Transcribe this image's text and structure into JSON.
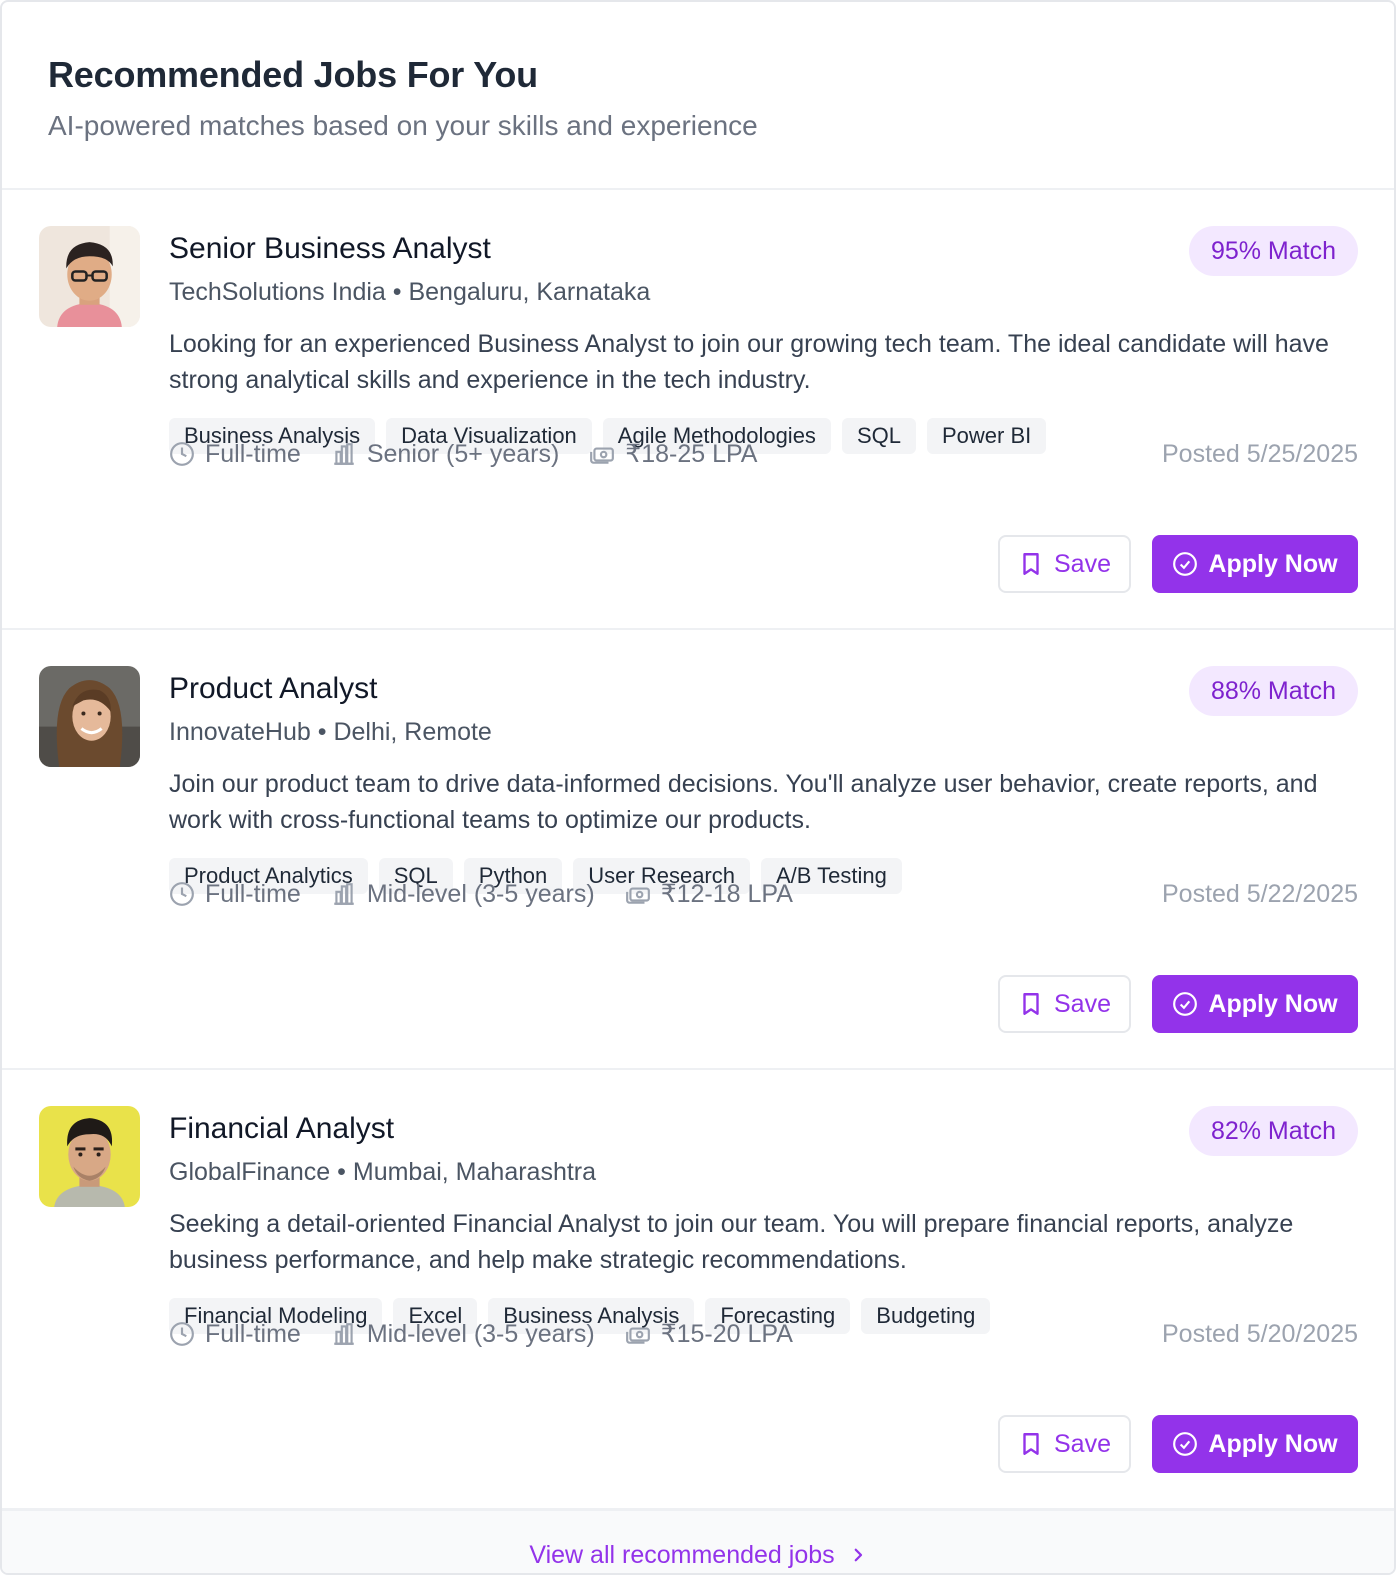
{
  "header": {
    "title": "Recommended Jobs For You",
    "subtitle": "AI-powered matches based on your skills and experience"
  },
  "jobs": [
    {
      "title": "Senior Business Analyst",
      "company": "TechSolutions India",
      "location": "Bengaluru, Karnataka",
      "match": "95% Match",
      "description": "Looking for an experienced Business Analyst to join our growing tech team. The ideal candidate will have strong analytical skills and experience in the tech industry.",
      "tags": [
        "Business Analysis",
        "Data Visualization",
        "Agile Methodologies",
        "SQL",
        "Power BI"
      ],
      "type": "Full-time",
      "level": "Senior (5+ years)",
      "salary": "₹18-25 LPA",
      "posted": "Posted 5/25/2025",
      "save_label": "Save",
      "apply_label": "Apply Now"
    },
    {
      "title": "Product Analyst",
      "company": "InnovateHub",
      "location": "Delhi, Remote",
      "match": "88% Match",
      "description": "Join our product team to drive data-informed decisions. You'll analyze user behavior, create reports, and work with cross-functional teams to optimize our products.",
      "tags": [
        "Product Analytics",
        "SQL",
        "Python",
        "User Research",
        "A/B Testing"
      ],
      "type": "Full-time",
      "level": "Mid-level (3-5 years)",
      "salary": "₹12-18 LPA",
      "posted": "Posted 5/22/2025",
      "save_label": "Save",
      "apply_label": "Apply Now"
    },
    {
      "title": "Financial Analyst",
      "company": "GlobalFinance",
      "location": "Mumbai, Maharashtra",
      "match": "82% Match",
      "description": "Seeking a detail-oriented Financial Analyst to join our team. You will prepare financial reports, analyze business performance, and help make strategic recommendations.",
      "tags": [
        "Financial Modeling",
        "Excel",
        "Business Analysis",
        "Forecasting",
        "Budgeting"
      ],
      "type": "Full-time",
      "level": "Mid-level (3-5 years)",
      "salary": "₹15-20 LPA",
      "posted": "Posted 5/20/2025",
      "save_label": "Save",
      "apply_label": "Apply Now"
    }
  ],
  "footer": {
    "view_all_label": "View all recommended jobs"
  },
  "colors": {
    "accent": "#9333ea",
    "match_bg": "#f3e8ff",
    "match_text": "#7e22ce",
    "tag_bg": "#f3f4f6"
  },
  "icons": [
    "clock-icon",
    "building-icon",
    "money-icon",
    "bookmark-icon",
    "check-circle-icon",
    "chevron-right-icon"
  ]
}
